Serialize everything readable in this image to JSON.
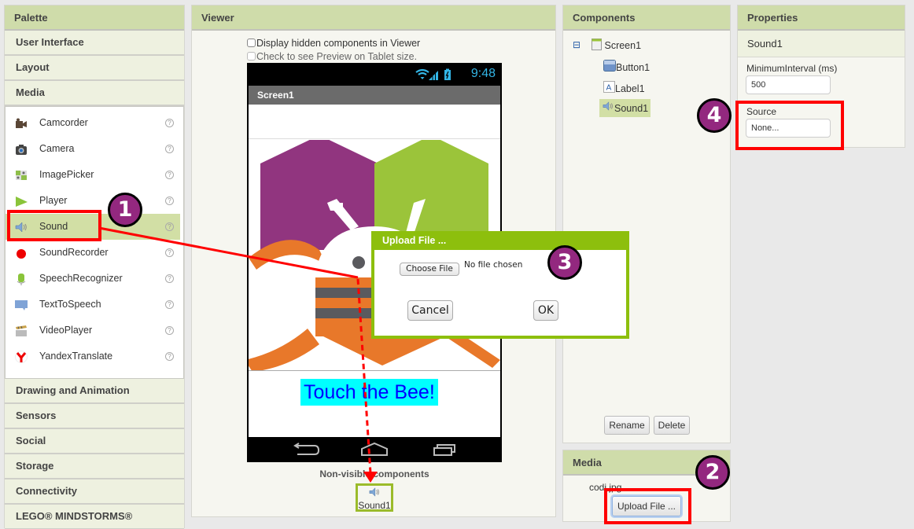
{
  "palette": {
    "title": "Palette",
    "categories_top": [
      "User Interface",
      "Layout",
      "Media"
    ],
    "media_items": [
      {
        "label": "Camcorder",
        "icon": "camcorder-icon"
      },
      {
        "label": "Camera",
        "icon": "camera-icon"
      },
      {
        "label": "ImagePicker",
        "icon": "image-picker-icon"
      },
      {
        "label": "Player",
        "icon": "player-icon"
      },
      {
        "label": "Sound",
        "icon": "sound-icon",
        "selected": true
      },
      {
        "label": "SoundRecorder",
        "icon": "sound-recorder-icon"
      },
      {
        "label": "SpeechRecognizer",
        "icon": "speech-recognizer-icon"
      },
      {
        "label": "TextToSpeech",
        "icon": "text-to-speech-icon"
      },
      {
        "label": "VideoPlayer",
        "icon": "video-player-icon"
      },
      {
        "label": "YandexTranslate",
        "icon": "yandex-translate-icon"
      }
    ],
    "help_glyph": "?",
    "categories_bottom": [
      "Drawing and Animation",
      "Sensors",
      "Social",
      "Storage",
      "Connectivity",
      "LEGO® MINDSTORMS®"
    ]
  },
  "viewer": {
    "title": "Viewer",
    "display_hidden_label": "Display hidden components in Viewer",
    "tablet_preview_label": "Check to see Preview on Tablet size.",
    "phone": {
      "clock": "9:48",
      "screen_title": "Screen1",
      "label_text": "Touch the Bee!"
    },
    "nonvisible_title": "Non-visible components",
    "nonvisible_items": [
      "Sound1"
    ]
  },
  "components": {
    "title": "Components",
    "collapse_glyph": "⊟",
    "tree": [
      {
        "label": "Screen1",
        "icon": "screen-icon"
      },
      {
        "label": "Button1",
        "icon": "button-icon"
      },
      {
        "label": "Label1",
        "icon": "label-icon"
      },
      {
        "label": "Sound1",
        "icon": "sound-icon",
        "selected": true
      }
    ],
    "rename_label": "Rename",
    "delete_label": "Delete"
  },
  "media": {
    "title": "Media",
    "files": [
      "codi.jpg"
    ],
    "upload_label": "Upload File ..."
  },
  "properties": {
    "title": "Properties",
    "component": "Sound1",
    "fields": [
      {
        "label": "MinimumInterval (ms)",
        "value": "500"
      },
      {
        "label": "Source",
        "value": "None..."
      }
    ]
  },
  "dialog": {
    "title": "Upload File ...",
    "choose_label": "Choose File",
    "no_file_text": "No file chosen",
    "cancel_label": "Cancel",
    "ok_label": "OK"
  },
  "annotations": {
    "badges": [
      "1",
      "2",
      "3",
      "4"
    ],
    "accent_red": "#ff0000",
    "badge_color": "#93287f"
  },
  "colors": {
    "panel_header": "#cfdcaa",
    "selected": "#d2dfa5",
    "dialog_green": "#8dbf0d",
    "clock_blue": "#33b5e5",
    "label_bg": "#00ffff",
    "label_fg": "#0000ff"
  }
}
